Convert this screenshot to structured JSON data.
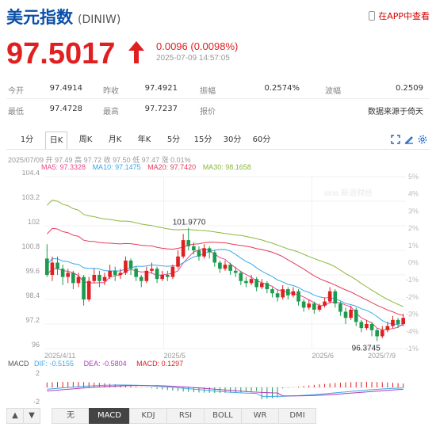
{
  "header": {
    "title": "美元指数",
    "code": "(DINIW)",
    "app_link": "在APP中查看"
  },
  "quote": {
    "price": "97.5017",
    "change": "0.0096 (0.0098%)",
    "timestamp": "2025-07-09 14:57:05",
    "color_up": "#e02020"
  },
  "stats": {
    "row1": [
      {
        "label": "今开",
        "value": "97.4914"
      },
      {
        "label": "昨收",
        "value": "97.4921"
      },
      {
        "label": "振幅",
        "value": "0.2574%"
      },
      {
        "label": "波幅",
        "value": "0.2509"
      }
    ],
    "row2": [
      {
        "label": "最低",
        "value": "97.4728"
      },
      {
        "label": "最高",
        "value": "97.7237"
      },
      {
        "label": "报价",
        "value": ""
      },
      {
        "label": "",
        "value": "数据来源于倚天"
      }
    ]
  },
  "period_tabs": [
    "1分",
    "日K",
    "周K",
    "月K",
    "年K",
    "5分",
    "15分",
    "30分",
    "60分"
  ],
  "active_period": "日K",
  "toolbar_icons": [
    "fullscreen-icon",
    "draw-icon",
    "settings-icon"
  ],
  "chart_info": {
    "ohlc_line": "2025/07/09 开 97.49 高 97.72 收 97.50 低 97.47 涨 0.01%",
    "ma": [
      {
        "label": "MA5: 97.3328",
        "color": "#e84a8a"
      },
      {
        "label": "MA10: 97.1475",
        "color": "#3aa8e8"
      },
      {
        "label": "MA20: 97.7420",
        "color": "#e83a5a"
      },
      {
        "label": "MA30: 98.1658",
        "color": "#8ab83a"
      }
    ],
    "watermark": "sina 新浪财经"
  },
  "chart_data": {
    "type": "candlestick",
    "y_ticks": [
      "104.4",
      "103.2",
      "102",
      "100.8",
      "99.6",
      "98.4",
      "97.2",
      "96"
    ],
    "y_right_ticks": [
      "5%",
      "4%",
      "3%",
      "2%",
      "1%",
      "0%",
      "-1%",
      "-2%",
      "-3%",
      "-4%",
      "-1%"
    ],
    "x_labels": [
      "2025/4/11",
      "2025/5",
      "2025/6",
      "2025/7/9"
    ],
    "annotations": [
      {
        "text": "101.9770",
        "type": "high"
      },
      {
        "text": "96.3745",
        "type": "low"
      }
    ],
    "ylim": [
      96,
      104.4
    ],
    "candles": [
      [
        100.4,
        99.6,
        101.1,
        99.5
      ],
      [
        99.6,
        100.2,
        100.5,
        99.3
      ],
      [
        100.2,
        99.9,
        100.5,
        99.6
      ],
      [
        99.9,
        99.5,
        100.1,
        99.1
      ],
      [
        99.5,
        99.7,
        99.9,
        99.2
      ],
      [
        99.7,
        99.2,
        99.8,
        98.9
      ],
      [
        99.2,
        99.5,
        99.7,
        99.0
      ],
      [
        99.5,
        98.4,
        99.6,
        98.1
      ],
      [
        98.4,
        99.3,
        99.5,
        98.3
      ],
      [
        99.3,
        99.6,
        99.9,
        99.2
      ],
      [
        99.6,
        99.3,
        99.8,
        99.0
      ],
      [
        99.3,
        99.5,
        99.7,
        99.1
      ],
      [
        99.5,
        99.8,
        100.1,
        99.4
      ],
      [
        99.8,
        99.6,
        100.0,
        99.3
      ],
      [
        99.6,
        99.7,
        99.9,
        99.4
      ],
      [
        99.7,
        100.3,
        100.5,
        99.6
      ],
      [
        100.3,
        99.9,
        100.4,
        99.6
      ],
      [
        99.9,
        99.5,
        100.0,
        99.3
      ],
      [
        99.5,
        99.3,
        99.6,
        99.0
      ],
      [
        99.3,
        99.8,
        100.0,
        99.2
      ],
      [
        99.8,
        99.9,
        100.2,
        99.7
      ],
      [
        99.9,
        99.4,
        100.0,
        99.2
      ],
      [
        99.4,
        99.6,
        99.8,
        99.3
      ],
      [
        99.6,
        99.5,
        99.8,
        99.3
      ],
      [
        99.5,
        100.0,
        100.1,
        99.4
      ],
      [
        100.0,
        100.5,
        100.8,
        99.9
      ],
      [
        100.5,
        101.3,
        101.6,
        100.4
      ],
      [
        101.3,
        101.0,
        101.9,
        100.8
      ],
      [
        101.0,
        100.8,
        101.2,
        100.6
      ],
      [
        100.8,
        100.5,
        101.0,
        100.3
      ],
      [
        100.5,
        100.9,
        101.1,
        100.4
      ],
      [
        100.9,
        100.7,
        101.0,
        100.4
      ],
      [
        100.7,
        100.2,
        100.8,
        100.0
      ],
      [
        100.2,
        99.9,
        100.3,
        99.7
      ],
      [
        99.9,
        100.1,
        100.3,
        99.8
      ],
      [
        100.1,
        99.8,
        100.2,
        99.6
      ],
      [
        99.8,
        99.7,
        100.0,
        99.5
      ],
      [
        99.7,
        99.3,
        99.8,
        99.1
      ],
      [
        99.3,
        99.2,
        99.5,
        99.0
      ],
      [
        99.2,
        99.4,
        99.6,
        99.1
      ],
      [
        99.4,
        99.0,
        99.5,
        98.8
      ],
      [
        99.0,
        99.2,
        99.4,
        98.9
      ],
      [
        99.2,
        98.9,
        99.3,
        98.7
      ],
      [
        98.9,
        98.7,
        99.0,
        98.5
      ],
      [
        98.7,
        98.5,
        98.9,
        98.3
      ],
      [
        98.5,
        98.9,
        99.1,
        98.4
      ],
      [
        98.9,
        98.6,
        99.0,
        98.4
      ],
      [
        98.6,
        98.8,
        99.0,
        98.5
      ],
      [
        98.8,
        98.3,
        98.9,
        98.1
      ],
      [
        98.3,
        98.0,
        98.4,
        97.8
      ],
      [
        98.0,
        98.2,
        98.4,
        97.9
      ],
      [
        98.2,
        97.9,
        98.3,
        97.7
      ],
      [
        97.9,
        98.1,
        98.2,
        97.8
      ],
      [
        98.1,
        98.3,
        98.5,
        98.0
      ],
      [
        98.3,
        98.8,
        99.0,
        98.2
      ],
      [
        98.8,
        98.2,
        98.9,
        98.0
      ],
      [
        98.2,
        97.8,
        98.3,
        97.6
      ],
      [
        97.8,
        97.5,
        98.0,
        97.2
      ],
      [
        97.5,
        97.9,
        98.1,
        97.4
      ],
      [
        97.9,
        97.3,
        98.0,
        97.1
      ],
      [
        97.3,
        97.0,
        97.4,
        96.8
      ],
      [
        97.0,
        97.2,
        97.4,
        96.9
      ],
      [
        97.2,
        96.9,
        97.3,
        96.6
      ],
      [
        96.9,
        96.6,
        97.0,
        96.37
      ],
      [
        96.6,
        96.9,
        97.1,
        96.5
      ],
      [
        96.9,
        97.1,
        97.3,
        96.8
      ],
      [
        97.1,
        97.4,
        97.6,
        97.0
      ],
      [
        97.4,
        97.2,
        97.5,
        97.0
      ],
      [
        97.2,
        97.5,
        97.7,
        97.1
      ]
    ]
  },
  "macd": {
    "label": "MACD",
    "dif": "DIF: -0.5155",
    "dea": "DEA: -0.5804",
    "macd": "MACD: 0.1297",
    "y_ticks": [
      "2",
      "-2"
    ]
  },
  "indicator_tabs": [
    "无",
    "MACD",
    "KDJ",
    "RSI",
    "BOLL",
    "WR",
    "DMI"
  ],
  "active_indicator": "MACD",
  "nav_arrows": [
    "▲",
    "▼"
  ]
}
